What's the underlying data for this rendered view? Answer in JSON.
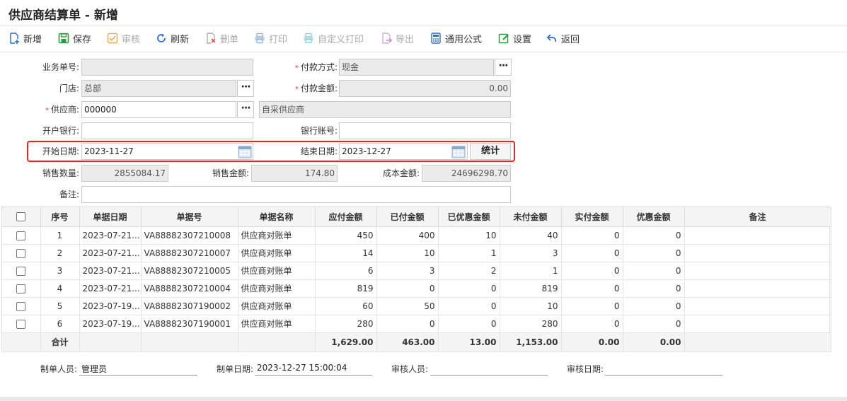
{
  "title": "供应商结算单 - 新增",
  "toolbar": {
    "new": "新增",
    "save": "保存",
    "audit": "审核",
    "refresh": "刷新",
    "delete": "删单",
    "print": "打印",
    "custom_print": "自定义打印",
    "export": "导出",
    "formula": "通用公式",
    "settings": "设置",
    "back": "返回"
  },
  "form": {
    "biz_no_label": "业务单号:",
    "biz_no_value": "",
    "pay_method_label": "付款方式:",
    "pay_method_value": "现金",
    "store_label": "门店:",
    "store_value": "总部",
    "pay_amount_label": "付款金额:",
    "pay_amount_value": "0.00",
    "supplier_label": "供应商:",
    "supplier_value": "000000",
    "supplier_name": "自采供应商",
    "bank_label": "开户银行:",
    "bank_value": "",
    "account_label": "银行账号:",
    "account_value": "",
    "start_date_label": "开始日期:",
    "start_date_value": "2023-11-27",
    "end_date_label": "结束日期:",
    "end_date_value": "2023-12-27",
    "stat_button": "统计",
    "sales_qty_label": "销售数量:",
    "sales_qty_value": "2855084.17",
    "sales_amount_label": "销售金额:",
    "sales_amount_value": "174.80",
    "cost_amount_label": "成本金额:",
    "cost_amount_value": "24696298.70",
    "remark_label": "备注:",
    "remark_value": ""
  },
  "table": {
    "headers": [
      "序号",
      "单据日期",
      "单据号",
      "单据名称",
      "应付金额",
      "已付金额",
      "已优惠金额",
      "未付金额",
      "实付金额",
      "优惠金额",
      "备注"
    ],
    "rows": [
      {
        "no": "1",
        "date": "2023-07-21...",
        "doc_no": "VA88882307210008",
        "doc_name": "供应商对账单",
        "payable": "450",
        "paid": "400",
        "discounted": "10",
        "unpaid": "40",
        "actual_paid": "0",
        "discount": "0",
        "remark": ""
      },
      {
        "no": "2",
        "date": "2023-07-21...",
        "doc_no": "VA88882307210007",
        "doc_name": "供应商对账单",
        "payable": "14",
        "paid": "10",
        "discounted": "1",
        "unpaid": "3",
        "actual_paid": "0",
        "discount": "0",
        "remark": ""
      },
      {
        "no": "3",
        "date": "2023-07-21...",
        "doc_no": "VA88882307210005",
        "doc_name": "供应商对账单",
        "payable": "6",
        "paid": "3",
        "discounted": "2",
        "unpaid": "1",
        "actual_paid": "0",
        "discount": "0",
        "remark": ""
      },
      {
        "no": "4",
        "date": "2023-07-21...",
        "doc_no": "VA88882307210004",
        "doc_name": "供应商对账单",
        "payable": "819",
        "paid": "0",
        "discounted": "0",
        "unpaid": "819",
        "actual_paid": "0",
        "discount": "0",
        "remark": ""
      },
      {
        "no": "5",
        "date": "2023-07-19...",
        "doc_no": "VA88882307190002",
        "doc_name": "供应商对账单",
        "payable": "60",
        "paid": "50",
        "discounted": "0",
        "unpaid": "10",
        "actual_paid": "0",
        "discount": "0",
        "remark": ""
      },
      {
        "no": "6",
        "date": "2023-07-19...",
        "doc_no": "VA88882307190001",
        "doc_name": "供应商对账单",
        "payable": "280",
        "paid": "0",
        "discounted": "0",
        "unpaid": "280",
        "actual_paid": "0",
        "discount": "0",
        "remark": ""
      }
    ],
    "total": {
      "label": "合计",
      "payable": "1,629.00",
      "paid": "463.00",
      "discounted": "13.00",
      "unpaid": "1,153.00",
      "actual_paid": "0.00",
      "discount": "0.00"
    }
  },
  "footer": {
    "creator_label": "制单人员:",
    "creator_value": "管理员",
    "create_date_label": "制单日期:",
    "create_date_value": "2023-12-27 15:00:04",
    "auditor_label": "审核人员:",
    "auditor_value": "",
    "audit_date_label": "审核日期:",
    "audit_date_value": ""
  },
  "colors": {
    "highlight_border": "#e8261f",
    "readonly_bg": "#ebebeb",
    "header_bg": "#f4f4f4"
  }
}
